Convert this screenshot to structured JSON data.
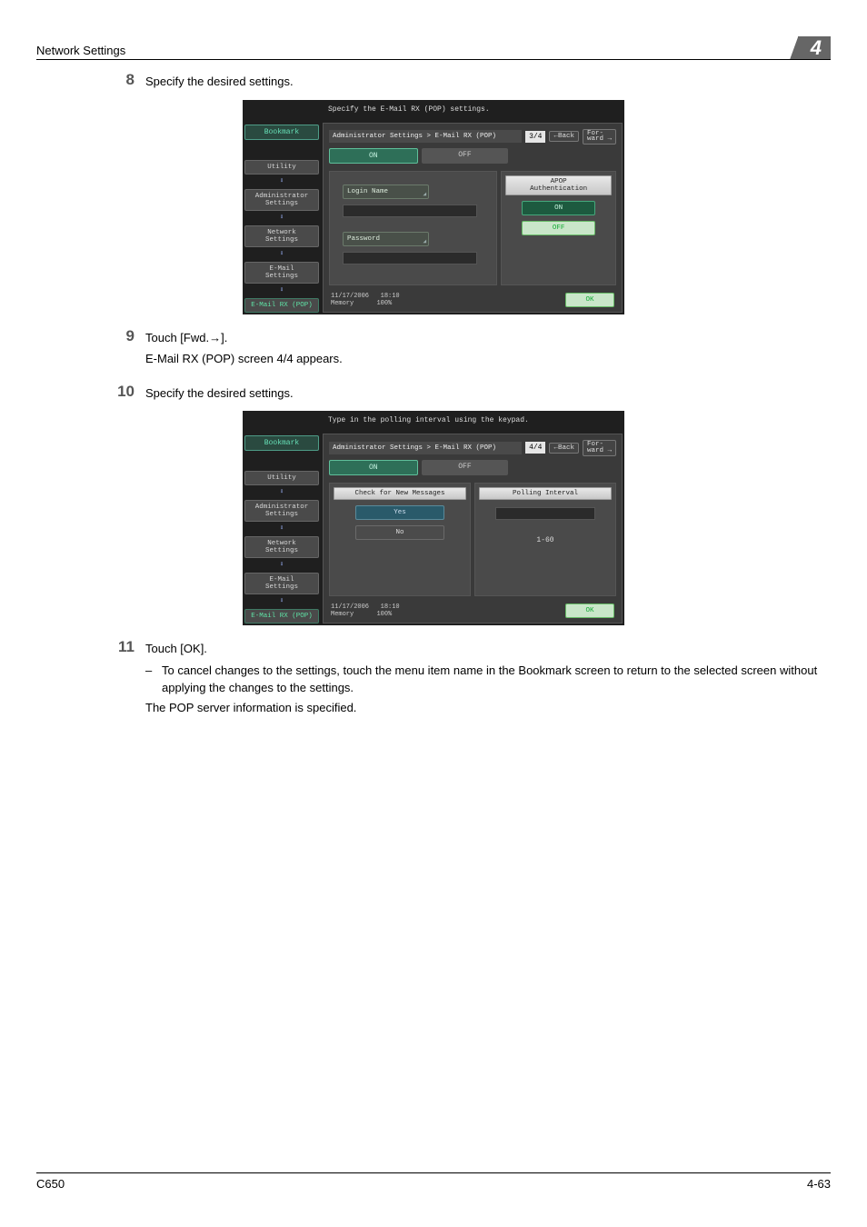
{
  "header": {
    "section": "Network Settings",
    "chapter": "4"
  },
  "footer": {
    "left": "C650",
    "right": "4-63"
  },
  "steps": {
    "s8": {
      "num": "8",
      "text": "Specify the desired settings."
    },
    "s9": {
      "num": "9",
      "line1": "Touch [Fwd.→].",
      "line2": "E-Mail RX (POP) screen 4/4 appears."
    },
    "s10": {
      "num": "10",
      "text": "Specify the desired settings."
    },
    "s11": {
      "num": "11",
      "line1": "Touch [OK].",
      "dash": "To cancel changes to the settings, touch the menu item name in the Bookmark screen to return to the selected screen without applying the changes to the settings.",
      "line2": "The POP server information is specified."
    }
  },
  "ss1": {
    "prompt": "Specify the E-Mail RX (POP) settings.",
    "bookmark": "Bookmark",
    "nav": {
      "utility": "Utility",
      "admin": "Administrator\nSettings",
      "network": "Network\nSettings",
      "email": "E-Mail\nSettings",
      "current": "E-Mail RX (POP)"
    },
    "crumb": "Administrator Settings > E-Mail RX (POP)",
    "page": "3/4",
    "back": "←Back",
    "fwd": "For-\nward →",
    "on": "ON",
    "off_tab": "OFF",
    "login": "Login Name",
    "password": "Password",
    "apop": "APOP\nAuthentication",
    "apop_on": "ON",
    "apop_off": "OFF",
    "date": "11/17/2006",
    "time": "18:10",
    "mem_lbl": "Memory",
    "mem_val": "100%",
    "ok": "OK"
  },
  "ss2": {
    "prompt": "Type in the polling interval using the keypad.",
    "bookmark": "Bookmark",
    "nav": {
      "utility": "Utility",
      "admin": "Administrator\nSettings",
      "network": "Network\nSettings",
      "email": "E-Mail\nSettings",
      "current": "E-Mail RX (POP)"
    },
    "crumb": "Administrator Settings > E-Mail RX (POP)",
    "page": "4/4",
    "back": "←Back",
    "fwd": "For-\nward →",
    "on": "ON",
    "off_tab": "OFF",
    "check_head": "Check for New Messages",
    "yes": "Yes",
    "no": "No",
    "poll_head": "Polling Interval",
    "poll_range": "1-60",
    "date": "11/17/2006",
    "time": "18:10",
    "mem_lbl": "Memory",
    "mem_val": "100%",
    "ok": "OK"
  }
}
